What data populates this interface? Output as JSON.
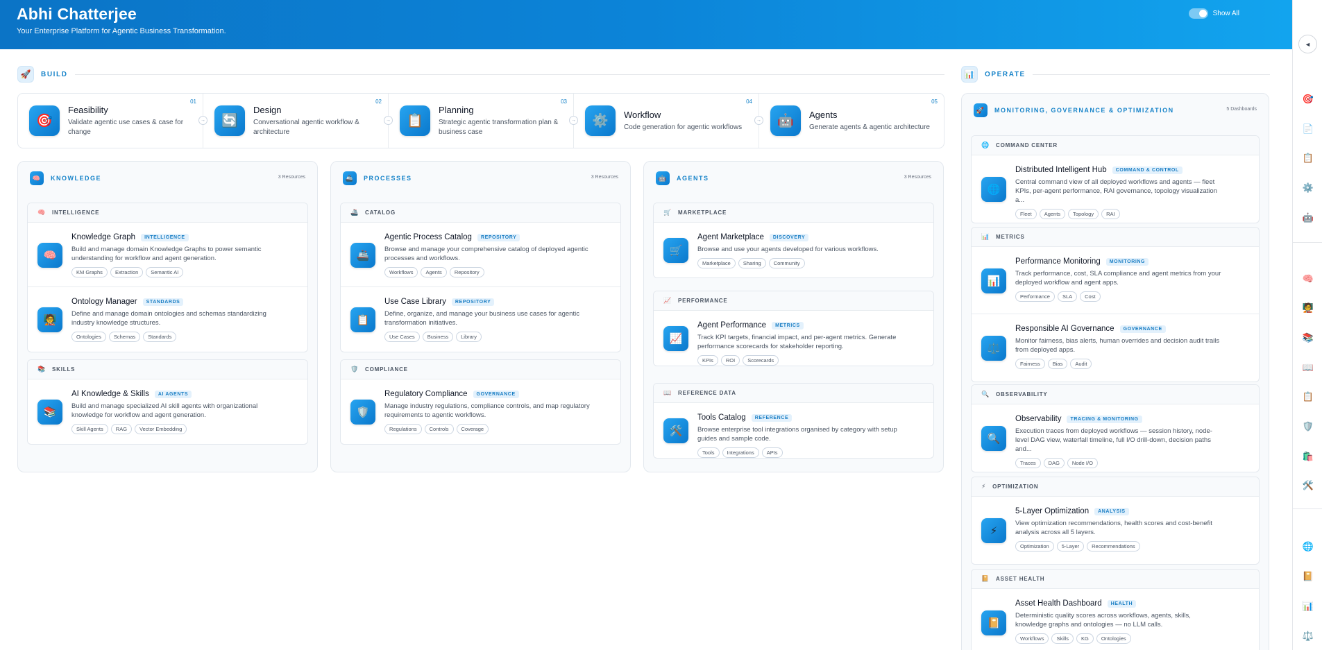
{
  "header": {
    "title": "Abhi Chatterjee",
    "subtitle": "Your Enterprise Platform for Agentic Business Transformation.",
    "toggle_label": "Show All"
  },
  "build": {
    "label": "BUILD",
    "icon": "🚀",
    "steps": [
      {
        "num": "01",
        "title": "Feasibility",
        "desc": "Validate agentic use cases & case for change",
        "icon": "🎯"
      },
      {
        "num": "02",
        "title": "Design",
        "desc": "Conversational agentic workflow & architecture",
        "icon": "🔄"
      },
      {
        "num": "03",
        "title": "Planning",
        "desc": "Strategic agentic transformation plan & business case",
        "icon": "📋"
      },
      {
        "num": "04",
        "title": "Workflow",
        "desc": "Code generation for agentic workflows",
        "icon": "⚙️"
      },
      {
        "num": "05",
        "title": "Agents",
        "desc": "Generate agents & agentic architecture",
        "icon": "🤖"
      }
    ]
  },
  "knowledge": {
    "title": "KNOWLEDGE",
    "count": "3 Resources",
    "icon": "🧠",
    "groups": [
      {
        "name": "INTELLIGENCE",
        "icon": "🧠",
        "items": [
          {
            "title": "Knowledge Graph",
            "badge": "INTELLIGENCE",
            "icon": "🧠",
            "desc": "Build and manage domain Knowledge Graphs to power semantic understanding for workflow and agent generation.",
            "tags": [
              "KM Graphs",
              "Extraction",
              "Semantic AI"
            ]
          },
          {
            "title": "Ontology Manager",
            "badge": "STANDARDS",
            "icon": "🧑‍🏫",
            "desc": "Define and manage domain ontologies and schemas standardizing industry knowledge structures.",
            "tags": [
              "Ontologies",
              "Schemas",
              "Standards"
            ]
          }
        ]
      },
      {
        "name": "SKILLS",
        "icon": "📚",
        "items": [
          {
            "title": "AI Knowledge & Skills",
            "badge": "AI AGENTS",
            "icon": "📚",
            "desc": "Build and manage specialized AI skill agents with organizational knowledge for workflow and agent generation.",
            "tags": [
              "Skill Agents",
              "RAG",
              "Vector Embedding"
            ]
          }
        ]
      }
    ]
  },
  "processes": {
    "title": "PROCESSES",
    "count": "3 Resources",
    "icon": "🚢",
    "groups": [
      {
        "name": "CATALOG",
        "icon": "🚢",
        "items": [
          {
            "title": "Agentic Process Catalog",
            "badge": "REPOSITORY",
            "icon": "🚢",
            "desc": "Browse and manage your comprehensive catalog of deployed agentic processes and workflows.",
            "tags": [
              "Workflows",
              "Agents",
              "Repository"
            ]
          },
          {
            "title": "Use Case Library",
            "badge": "REPOSITORY",
            "icon": "📋",
            "desc": "Define, organize, and manage your business use cases for agentic transformation initiatives.",
            "tags": [
              "Use Cases",
              "Business",
              "Library"
            ]
          }
        ]
      },
      {
        "name": "COMPLIANCE",
        "icon": "🛡️",
        "items": [
          {
            "title": "Regulatory Compliance",
            "badge": "GOVERNANCE",
            "icon": "🛡️",
            "desc": "Manage industry regulations, compliance controls, and map regulatory requirements to agentic workflows.",
            "tags": [
              "Regulations",
              "Controls",
              "Coverage"
            ]
          }
        ]
      }
    ]
  },
  "agents": {
    "title": "AGENTS",
    "count": "3 Resources",
    "icon": "🤖",
    "groups": [
      {
        "name": "MARKETPLACE",
        "icon": "🛒",
        "items": [
          {
            "title": "Agent Marketplace",
            "badge": "DISCOVERY",
            "icon": "🛒",
            "desc": "Browse and use your agents developed for various workflows.",
            "tags": [
              "Marketplace",
              "Sharing",
              "Community"
            ]
          }
        ]
      },
      {
        "name": "PERFORMANCE",
        "icon": "📈",
        "items": [
          {
            "title": "Agent Performance",
            "badge": "METRICS",
            "icon": "📈",
            "desc": "Track KPI targets, financial impact, and per-agent metrics. Generate performance scorecards for stakeholder reporting.",
            "tags": [
              "KPIs",
              "ROI",
              "Scorecards"
            ]
          }
        ]
      },
      {
        "name": "REFERENCE DATA",
        "icon": "📖",
        "items": [
          {
            "title": "Tools Catalog",
            "badge": "REFERENCE",
            "icon": "🛠️",
            "desc": "Browse enterprise tool integrations organised by category with setup guides and sample code.",
            "tags": [
              "Tools",
              "Integrations",
              "APIs"
            ]
          }
        ]
      }
    ]
  },
  "operate": {
    "label": "OPERATE",
    "icon": "📊",
    "panel_title": "MONITORING, GOVERNANCE & OPTIMIZATION",
    "count": "5 Dashboards",
    "panel_icon": "🚀",
    "groups": [
      {
        "name": "COMMAND CENTER",
        "icon": "🌐",
        "items": [
          {
            "title": "Distributed Intelligent Hub",
            "badge": "COMMAND & CONTROL",
            "icon": "🌐",
            "desc": "Central command view of all deployed workflows and agents — fleet KPIs, per-agent performance, RAI governance, topology visualization a...",
            "tags": [
              "Fleet",
              "Agents",
              "Topology",
              "RAI"
            ]
          }
        ]
      },
      {
        "name": "METRICS",
        "icon": "📊",
        "items": [
          {
            "title": "Performance Monitoring",
            "badge": "MONITORING",
            "icon": "📊",
            "desc": "Track performance, cost, SLA compliance and agent metrics from your deployed workflow and agent apps.",
            "tags": [
              "Performance",
              "SLA",
              "Cost"
            ]
          },
          {
            "title": "Responsible AI Governance",
            "badge": "GOVERNANCE",
            "icon": "⚖️",
            "desc": "Monitor fairness, bias alerts, human overrides and decision audit trails from deployed apps.",
            "tags": [
              "Fairness",
              "Bias",
              "Audit"
            ]
          }
        ]
      },
      {
        "name": "OBSERVABILITY",
        "icon": "🔍",
        "items": [
          {
            "title": "Observability",
            "badge": "TRACING & MONITORING",
            "icon": "🔍",
            "desc": "Execution traces from deployed workflows — session history, node-level DAG view, waterfall timeline, full I/O drill-down, decision paths and...",
            "tags": [
              "Traces",
              "DAG",
              "Node I/O"
            ]
          }
        ]
      },
      {
        "name": "OPTIMIZATION",
        "icon": "⚡",
        "items": [
          {
            "title": "5-Layer Optimization",
            "badge": "ANALYSIS",
            "icon": "⚡",
            "desc": "View optimization recommendations, health scores and cost-benefit analysis across all 5 layers.",
            "tags": [
              "Optimization",
              "5-Layer",
              "Recommendations"
            ]
          }
        ]
      },
      {
        "name": "ASSET HEALTH",
        "icon": "📔",
        "items": [
          {
            "title": "Asset Health Dashboard",
            "badge": "HEALTH",
            "icon": "📔",
            "desc": "Deterministic quality scores across workflows, agents, skills, knowledge graphs and ontologies — no LLM calls.",
            "tags": [
              "Workflows",
              "Skills",
              "KG",
              "Ontologies"
            ]
          }
        ]
      }
    ]
  },
  "sidebar": {
    "collapse": "◄",
    "icons": [
      "🎯",
      "📄",
      "📋",
      "⚙️",
      "🤖",
      "🧠",
      "🧑‍🏫",
      "📚",
      "📖",
      "📋",
      "🛡️",
      "🛍️",
      "🛠️",
      "🌐",
      "📔",
      "📊",
      "⚖️"
    ]
  }
}
